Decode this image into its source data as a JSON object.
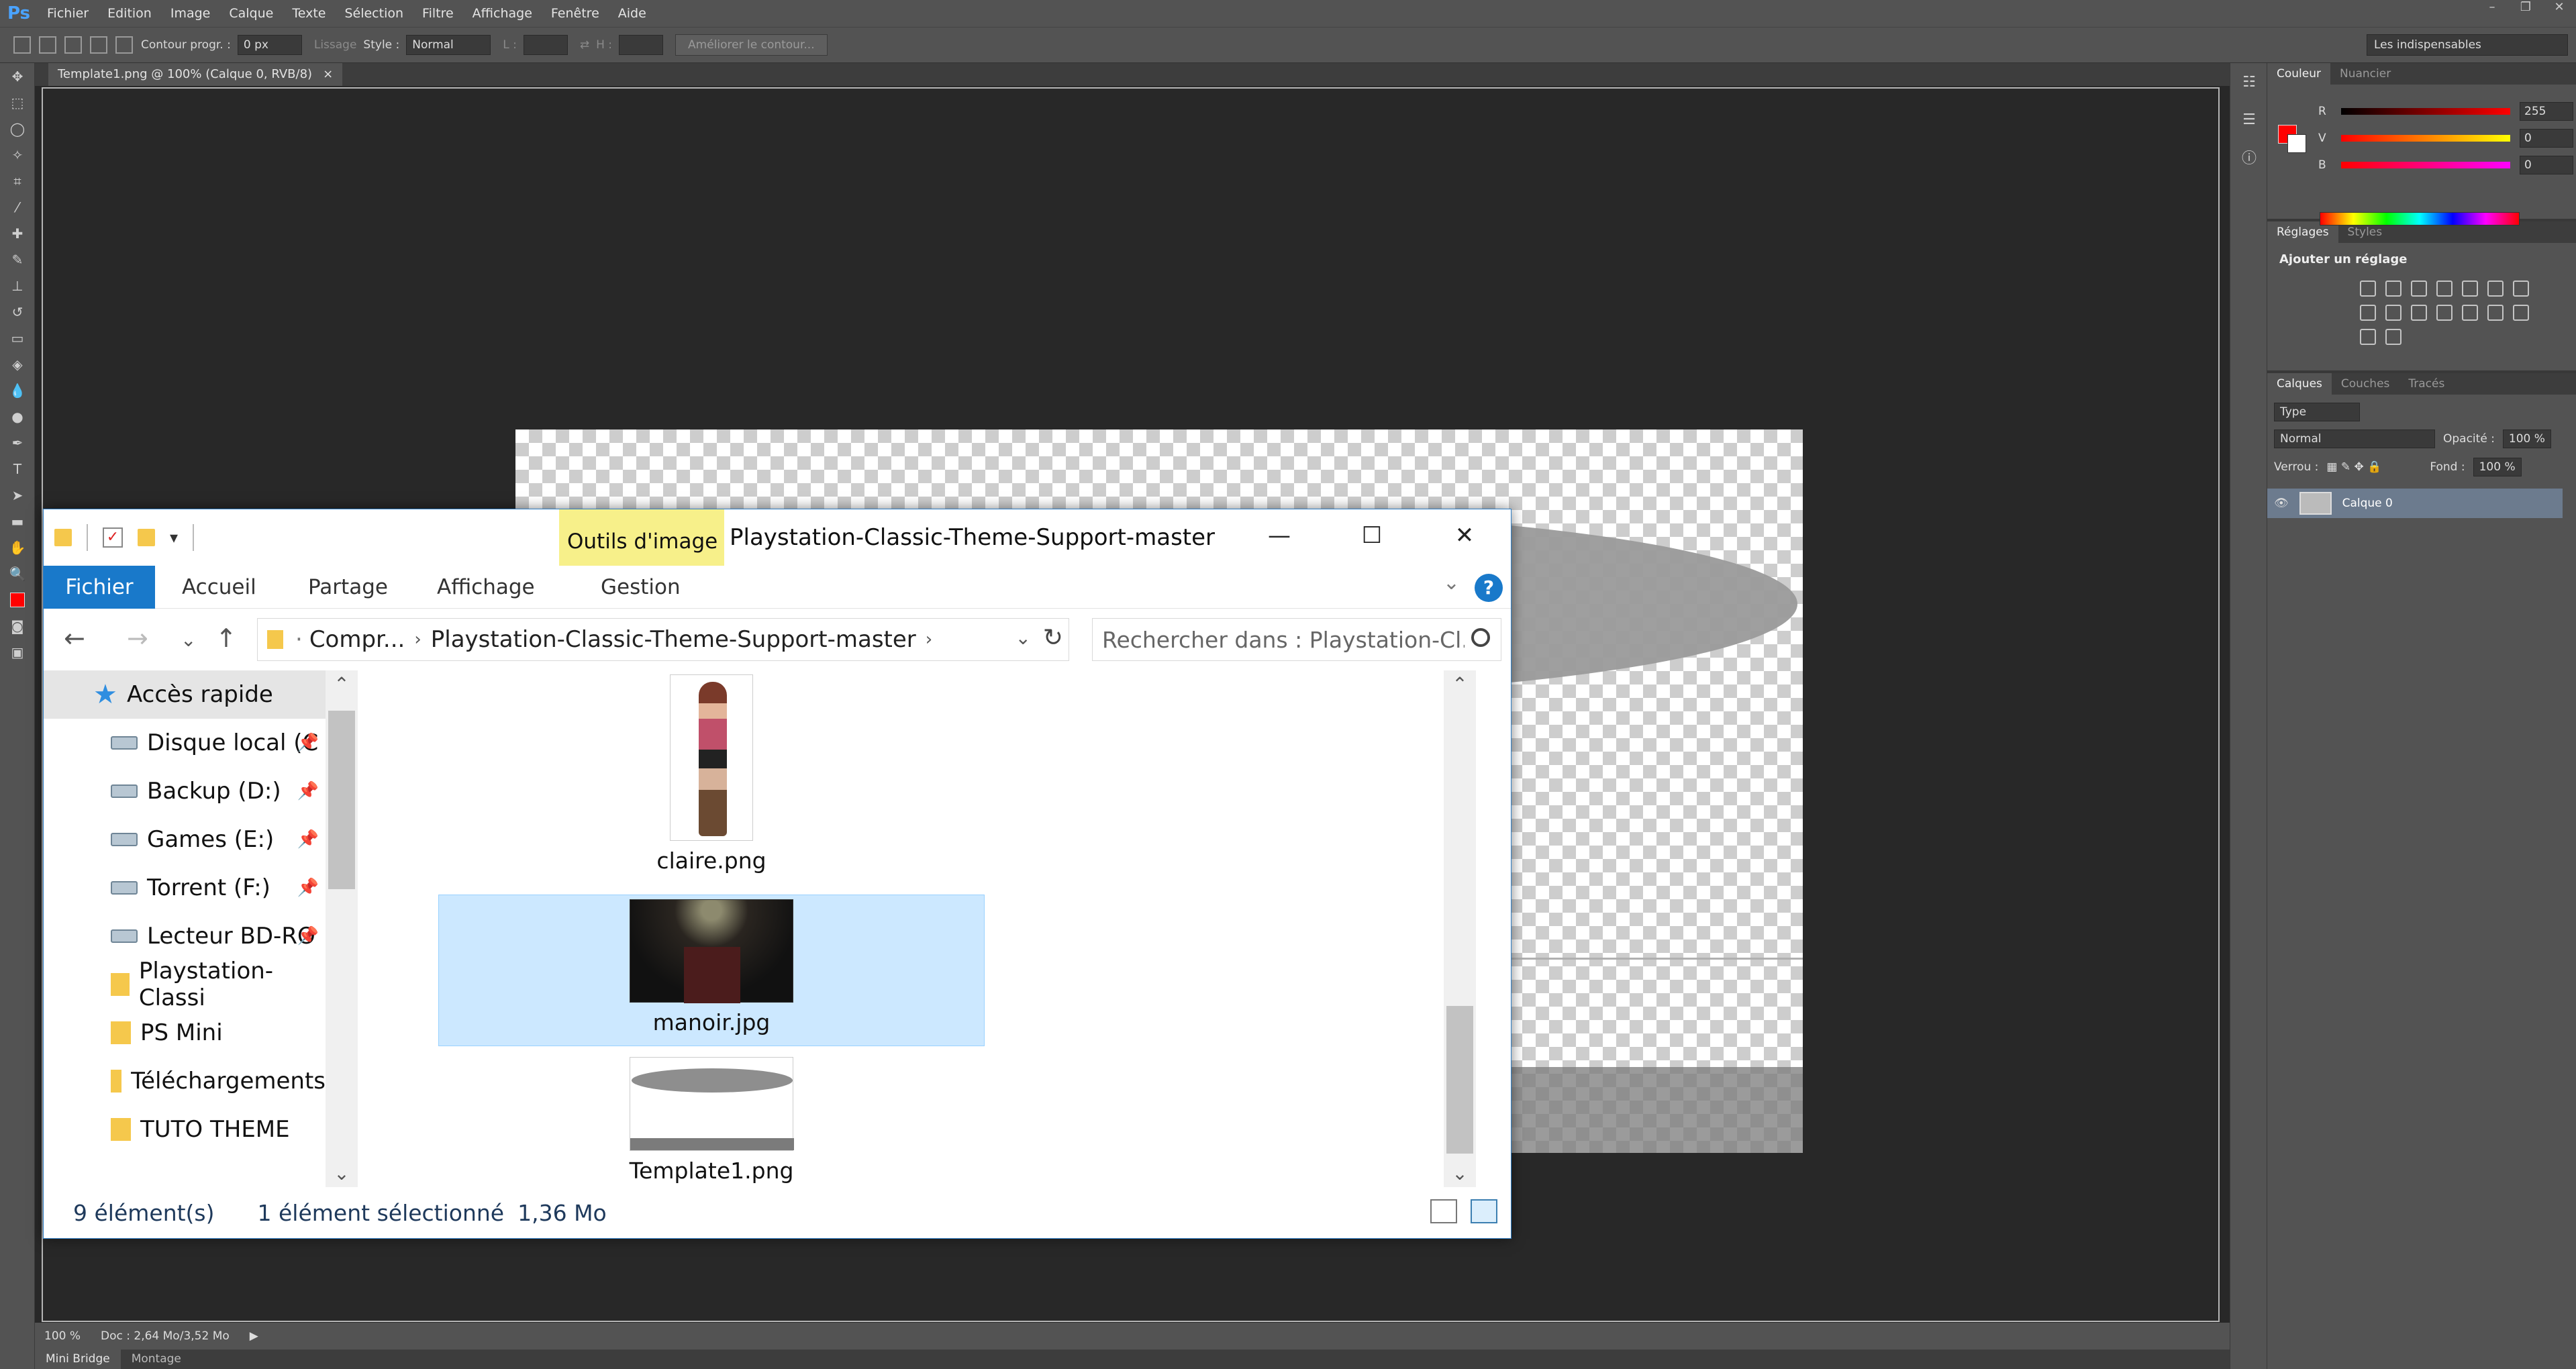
{
  "photoshop": {
    "logo": "Ps",
    "menu": [
      "Fichier",
      "Edition",
      "Image",
      "Calque",
      "Texte",
      "Sélection",
      "Filtre",
      "Affichage",
      "Fenêtre",
      "Aide"
    ],
    "options": {
      "feather_label": "Contour progr. :",
      "feather_value": "0 px",
      "antialias_label": "Lissage",
      "style_label": "Style :",
      "style_value": "Normal",
      "width_label": "L :",
      "height_label": "H :",
      "refine_button": "Améliorer le contour...",
      "workspace": "Les indispensables"
    },
    "document_tab": "Template1.png @ 100% (Calque 0, RVB/8)",
    "document_tab_close": "×",
    "status": {
      "zoom": "100 %",
      "doc": "Doc : 2,64 Mo/3,52 Mo"
    },
    "bottom_tabs": [
      "Mini Bridge",
      "Montage"
    ],
    "color_panel": {
      "tabs": [
        "Couleur",
        "Nuancier"
      ],
      "r_label": "R",
      "g_label": "V",
      "b_label": "B",
      "r": "255",
      "g": "0",
      "b": "0",
      "fg_color": "#ff0000",
      "bg_color": "#ffffff"
    },
    "adjustments_panel": {
      "tabs": [
        "Réglages",
        "Styles"
      ],
      "title": "Ajouter un réglage"
    },
    "layers_panel": {
      "tabs": [
        "Calques",
        "Couches",
        "Tracés"
      ],
      "filter": "Type",
      "blend_mode": "Normal",
      "opacity_label": "Opacité :",
      "opacity": "100 %",
      "lock_label": "Verrou :",
      "fill_label": "Fond :",
      "fill": "100 %",
      "layer_name": "Calque 0"
    }
  },
  "explorer": {
    "context_tab": "Outils d'image",
    "title": "Playstation-Classic-Theme-Support-master",
    "ribbon_tabs": [
      "Fichier",
      "Accueil",
      "Partage",
      "Affichage",
      "Gestion"
    ],
    "help": "?",
    "breadcrumb": [
      "Compr...",
      "Playstation-Classic-Theme-Support-master"
    ],
    "search_placeholder": "Rechercher dans : Playstation-Cl...",
    "nav_items": [
      {
        "label": "Accès rapide",
        "icon": "star-icon"
      },
      {
        "label": "Disque local (C",
        "icon": "drive-icon"
      },
      {
        "label": "Backup (D:)",
        "icon": "drive-icon"
      },
      {
        "label": "Games (E:)",
        "icon": "drive-icon"
      },
      {
        "label": "Torrent (F:)",
        "icon": "drive-icon"
      },
      {
        "label": "Lecteur BD-RO",
        "icon": "bd-drive-icon"
      },
      {
        "label": "Playstation-Classi",
        "icon": "folder-icon"
      },
      {
        "label": "PS Mini",
        "icon": "folder-icon"
      },
      {
        "label": "Téléchargements",
        "icon": "download-folder-icon"
      },
      {
        "label": "TUTO THEME",
        "icon": "folder-icon"
      }
    ],
    "files": [
      {
        "name": "claire.png",
        "selected": false
      },
      {
        "name": "manoir.jpg",
        "selected": true
      },
      {
        "name": "Template1.png",
        "selected": false
      }
    ],
    "status": {
      "count": "9 élément(s)",
      "selection": "1 élément sélectionné",
      "size": "1,36 Mo"
    },
    "selection_color": "#cce8ff",
    "accent": "#1979ca"
  }
}
